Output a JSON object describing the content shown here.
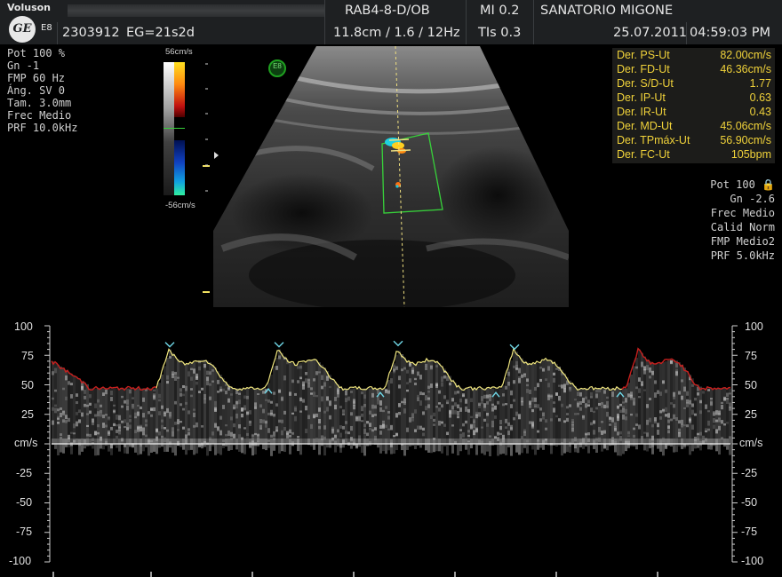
{
  "header": {
    "brand": "Voluson",
    "model": "E8",
    "logo_text": "GE",
    "patient_id": "2303912",
    "gest_age": "EG=21s2d",
    "preset": "RAB4-8-D/OB",
    "depth_freq": "11.8cm / 1.6 / 12Hz",
    "mi": "MI  0.2",
    "tis": "TIs  0.3",
    "institution": "SANATORIO MIGONE",
    "date": "25.07.2011",
    "time": "04:59:03 PM"
  },
  "color_scale": {
    "top": "56cm/s",
    "bottom": "-56cm/s"
  },
  "left_params": [
    "Pot 100 %",
    "Gn  -1",
    "FMP 60 Hz",
    "Áng. SV  0",
    "Tam.  3.0mm",
    "Frec Medio",
    "PRF 10.0kHz"
  ],
  "right_params": [
    "Pot 100 🔒",
    "Gn -2.6",
    "Frec Medio",
    "Calid Norm",
    "FMP Medio2",
    "PRF  5.0kHz"
  ],
  "marker": "E8",
  "measurements": [
    {
      "label": "Der. PS-Ut",
      "value": "82.00cm/s"
    },
    {
      "label": "Der. FD-Ut",
      "value": "46.36cm/s"
    },
    {
      "label": "Der. S/D-Ut",
      "value": "1.77"
    },
    {
      "label": "Der. IP-Ut",
      "value": "0.63"
    },
    {
      "label": "Der. IR-Ut",
      "value": "0.43"
    },
    {
      "label": "Der. MD-Ut",
      "value": "45.06cm/s"
    },
    {
      "label": "Der. TPmáx-Ut",
      "value": "56.90cm/s"
    },
    {
      "label": "Der. FC-Ut",
      "value": "105bpm"
    }
  ],
  "spectral": {
    "unit": "cm/s",
    "ticks": [
      "100",
      "75",
      "50",
      "25",
      "-25",
      "-50",
      "-75",
      "-100"
    ],
    "range": [
      -100,
      100
    ],
    "trace_color_red": "#c8201e",
    "trace_color_yellow": "#f2e880",
    "cursor_color": "#6fd6e6"
  },
  "colors": {
    "header_bg": "#1e2022",
    "measure_text": "#f0d23a",
    "roi_box": "#37d23a"
  }
}
